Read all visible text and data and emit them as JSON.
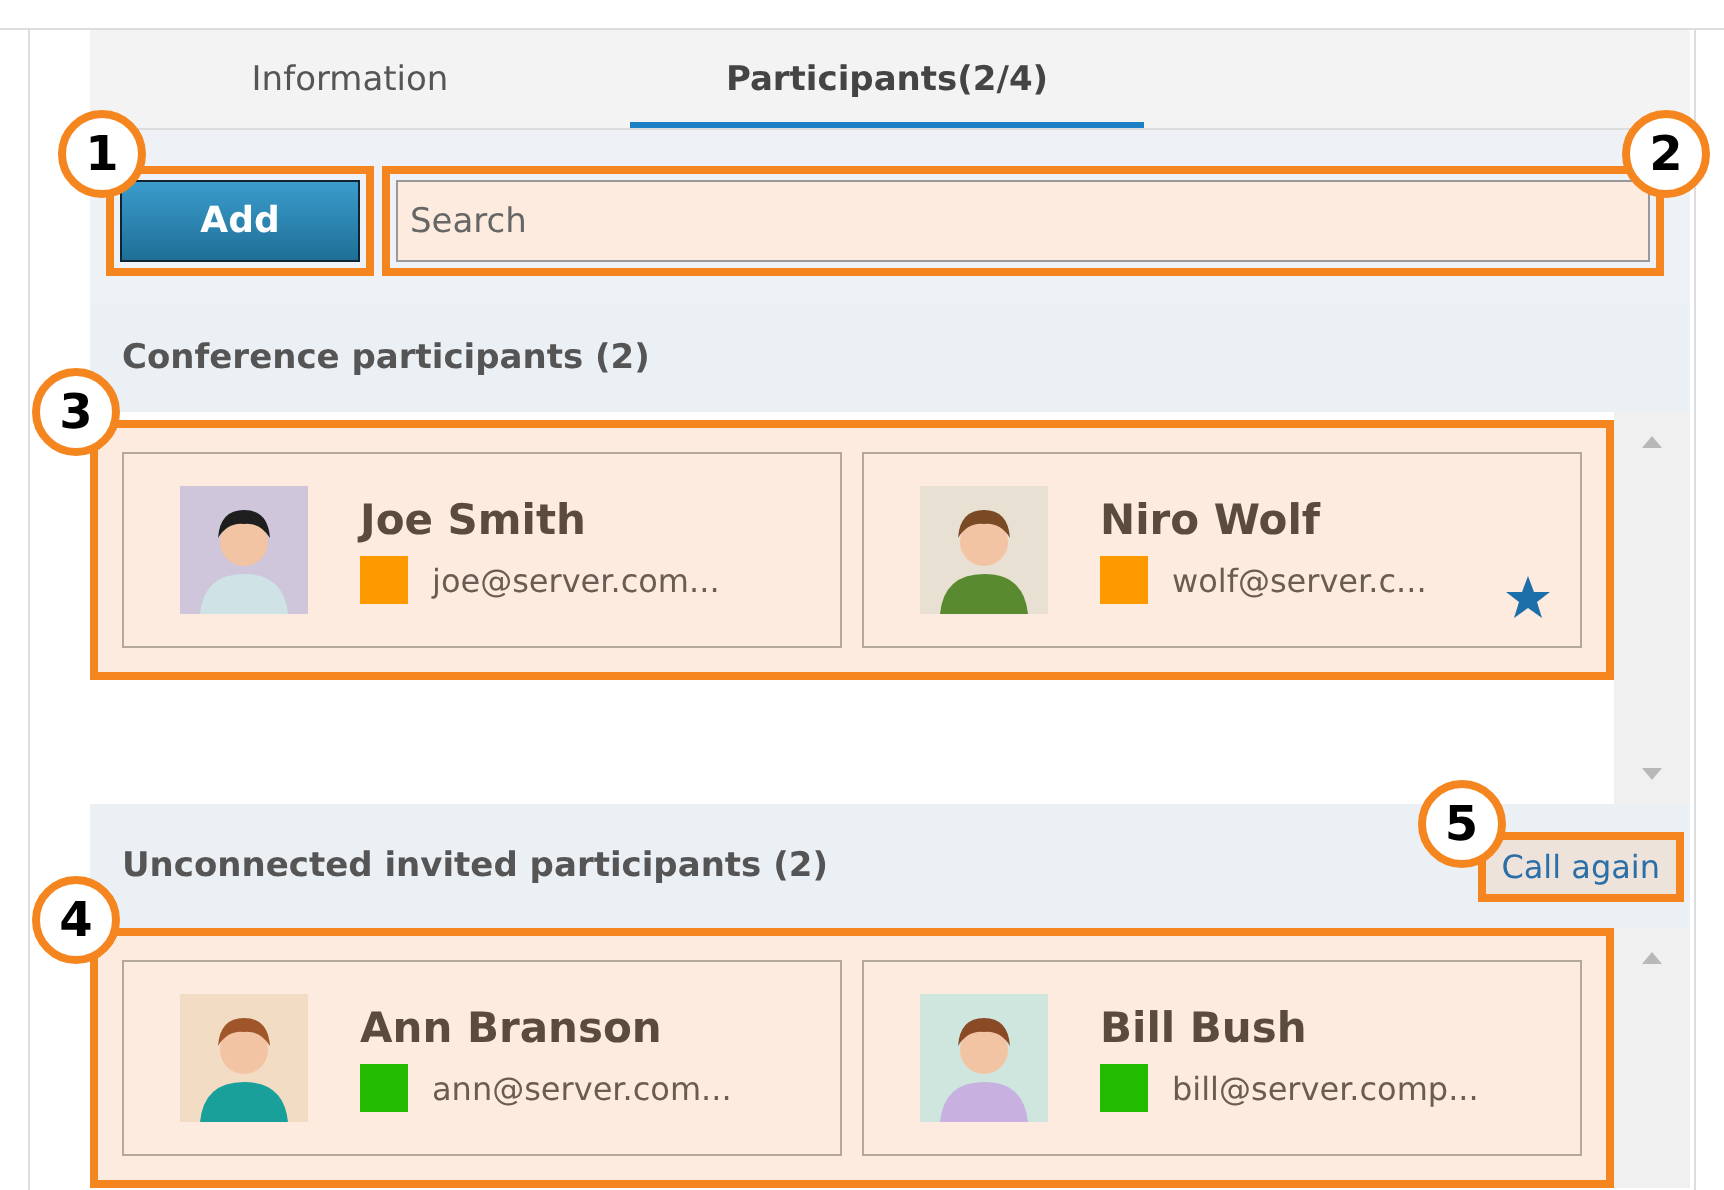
{
  "tabs": [
    {
      "label": "Information",
      "selected": false
    },
    {
      "label": "Participants(2/4)",
      "selected": true
    }
  ],
  "add_button": {
    "label": "Add",
    "callout": "1"
  },
  "search": {
    "placeholder": "Search",
    "callout": "2"
  },
  "sections": [
    {
      "title": "Conference participants (2)",
      "callout": "3",
      "participants": [
        {
          "name": "Joe Smith",
          "email": "joe@server.com...",
          "color": "#ff9900",
          "starred": false
        },
        {
          "name": "Niro Wolf",
          "email": "wolf@server.c...",
          "color": "#ff9900",
          "starred": true
        }
      ]
    },
    {
      "title": "Unconnected invited participants (2)",
      "callout": "4",
      "action": {
        "label": "Call again",
        "callout": "5"
      },
      "participants": [
        {
          "name": "Ann Branson",
          "email": "ann@server.com...",
          "color": "#22bb00",
          "starred": false
        },
        {
          "name": "Bill Bush",
          "email": "bill@server.comp...",
          "color": "#22bb00",
          "starred": false
        }
      ]
    }
  ]
}
